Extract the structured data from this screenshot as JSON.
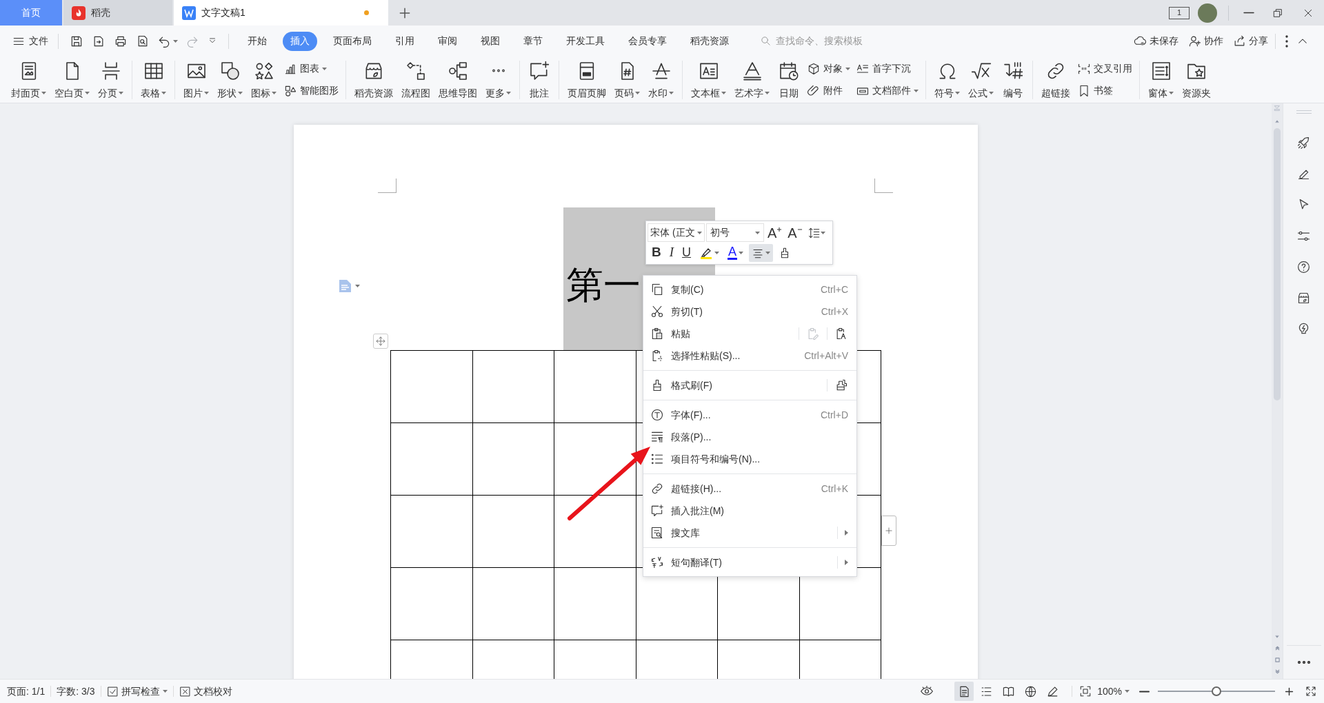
{
  "window": {
    "screen_badge": "1"
  },
  "tabs": [
    {
      "label": "首页",
      "kind": "home",
      "selected": false,
      "unsaved": false
    },
    {
      "label": "稻壳",
      "kind": "app",
      "selected": false,
      "unsaved": false
    },
    {
      "label": "文字文稿1",
      "kind": "document",
      "selected": true,
      "unsaved": true
    }
  ],
  "menu_bar": {
    "file": "文件",
    "ribbon_tabs": [
      {
        "label": "开始",
        "selected": false
      },
      {
        "label": "插入",
        "selected": true
      },
      {
        "label": "页面布局",
        "selected": false
      },
      {
        "label": "引用",
        "selected": false
      },
      {
        "label": "审阅",
        "selected": false
      },
      {
        "label": "视图",
        "selected": false
      },
      {
        "label": "章节",
        "selected": false
      },
      {
        "label": "开发工具",
        "selected": false
      },
      {
        "label": "会员专享",
        "selected": false
      },
      {
        "label": "稻壳资源",
        "selected": false
      }
    ],
    "search": {
      "placeholder": "查找命令、搜索模板"
    },
    "actions": [
      "未保存",
      "协作",
      "分享"
    ]
  },
  "ribbon": {
    "groups": [
      {
        "columns": [
          {
            "kind": "large",
            "label": "封面页",
            "dropdown": true
          },
          {
            "kind": "large",
            "label": "空白页",
            "dropdown": true
          },
          {
            "kind": "large",
            "label": "分页",
            "dropdown": true
          }
        ]
      },
      {
        "columns": [
          {
            "kind": "large",
            "label": "表格",
            "dropdown": true
          }
        ]
      },
      {
        "columns": [
          {
            "kind": "large",
            "label": "图片",
            "dropdown": true
          },
          {
            "kind": "large",
            "label": "形状",
            "dropdown": true
          },
          {
            "kind": "large",
            "label": "图标",
            "dropdown": true
          },
          {
            "kind": "stack",
            "items": [
              {
                "label": "图表",
                "dropdown": true
              },
              {
                "label": "智能图形",
                "dropdown": false
              }
            ]
          }
        ]
      },
      {
        "columns": [
          {
            "kind": "large",
            "label": "稻壳资源",
            "dropdown": false
          },
          {
            "kind": "large",
            "label": "流程图",
            "dropdown": false
          },
          {
            "kind": "large",
            "label": "思维导图",
            "dropdown": false
          },
          {
            "kind": "large",
            "label": "更多",
            "dropdown": true
          }
        ]
      },
      {
        "columns": [
          {
            "kind": "large",
            "label": "批注",
            "dropdown": false
          }
        ]
      },
      {
        "columns": [
          {
            "kind": "large",
            "label": "页眉页脚",
            "dropdown": false
          },
          {
            "kind": "large",
            "label": "页码",
            "dropdown": true
          },
          {
            "kind": "large",
            "label": "水印",
            "dropdown": true
          }
        ]
      },
      {
        "columns": [
          {
            "kind": "large",
            "label": "文本框",
            "dropdown": true
          },
          {
            "kind": "large",
            "label": "艺术字",
            "dropdown": true
          },
          {
            "kind": "large",
            "label": "日期",
            "dropdown": false
          },
          {
            "kind": "stack",
            "items": [
              {
                "label": "对象",
                "dropdown": true
              },
              {
                "label": "附件",
                "dropdown": false
              }
            ]
          },
          {
            "kind": "stack",
            "items": [
              {
                "label": "首字下沉",
                "dropdown": false
              },
              {
                "label": "文档部件",
                "dropdown": true
              }
            ]
          }
        ]
      },
      {
        "columns": [
          {
            "kind": "large",
            "label": "符号",
            "dropdown": true
          },
          {
            "kind": "large",
            "label": "公式",
            "dropdown": true
          },
          {
            "kind": "large",
            "label": "编号",
            "dropdown": false
          }
        ]
      },
      {
        "columns": [
          {
            "kind": "large",
            "label": "超链接",
            "dropdown": false
          },
          {
            "kind": "stack",
            "items": [
              {
                "label": "交叉引用",
                "dropdown": false
              },
              {
                "label": "书签",
                "dropdown": false
              }
            ]
          }
        ]
      },
      {
        "columns": [
          {
            "kind": "large",
            "label": "窗体",
            "dropdown": true
          },
          {
            "kind": "large",
            "label": "资源夹",
            "dropdown": false
          }
        ]
      }
    ]
  },
  "document": {
    "heading": "第一"
  },
  "mini_toolbar": {
    "font": "宋体 (正文",
    "size": "初号",
    "top_buttons": [
      {
        "kind": "grow-font",
        "label": "A",
        "dropdown": false
      },
      {
        "kind": "shrink-font",
        "label": "A",
        "dropdown": false
      },
      {
        "kind": "line-spacing",
        "dropdown": true
      }
    ],
    "bottom_buttons": [
      {
        "kind": "bold",
        "label": "B",
        "dropdown": false,
        "selected": false
      },
      {
        "kind": "italic",
        "label": "I",
        "dropdown": false,
        "selected": false
      },
      {
        "kind": "underline",
        "label": "U",
        "dropdown": false,
        "selected": false
      },
      {
        "kind": "highlight",
        "dropdown": true,
        "selected": false
      },
      {
        "kind": "font-color",
        "label": "A",
        "dropdown": true,
        "selected": false
      },
      {
        "kind": "align",
        "dropdown": true,
        "selected": true
      },
      {
        "kind": "painter",
        "dropdown": false,
        "selected": false
      }
    ]
  },
  "context_menu": {
    "groups": [
      [
        {
          "label": "复制(C)",
          "shortcut": "Ctrl+C",
          "submenu": false
        },
        {
          "label": "剪切(T)",
          "shortcut": "Ctrl+X",
          "submenu": false
        },
        {
          "label": "粘贴",
          "submenu": false,
          "paste_options": [
            {
              "disabled": true
            },
            {
              "disabled": false
            }
          ]
        },
        {
          "label": "选择性粘贴(S)...",
          "shortcut": "Ctrl+Alt+V",
          "submenu": false
        }
      ],
      [
        {
          "label": "格式刷(F)",
          "submenu": false,
          "extra_button": true
        }
      ],
      [
        {
          "label": "字体(F)...",
          "shortcut": "Ctrl+D",
          "submenu": false
        },
        {
          "label": "段落(P)...",
          "submenu": false
        },
        {
          "label": "项目符号和编号(N)...",
          "submenu": false
        }
      ],
      [
        {
          "label": "超链接(H)...",
          "shortcut": "Ctrl+K",
          "submenu": false
        },
        {
          "label": "插入批注(M)",
          "submenu": false
        },
        {
          "label": "搜文库",
          "submenu": true
        }
      ],
      [
        {
          "label": "短句翻译(T)",
          "submenu": true
        }
      ]
    ]
  },
  "status_bar": {
    "page": "页面: 1/1",
    "words": "字数: 3/3",
    "spell_check": "拼写检查",
    "proofread": "文档校对",
    "view_modes": [
      {
        "selected": true
      },
      {
        "selected": false
      },
      {
        "selected": false
      },
      {
        "selected": false
      },
      {
        "selected": false
      }
    ],
    "zoom": "100%",
    "zoom_slider": {
      "level": 0.5
    }
  }
}
